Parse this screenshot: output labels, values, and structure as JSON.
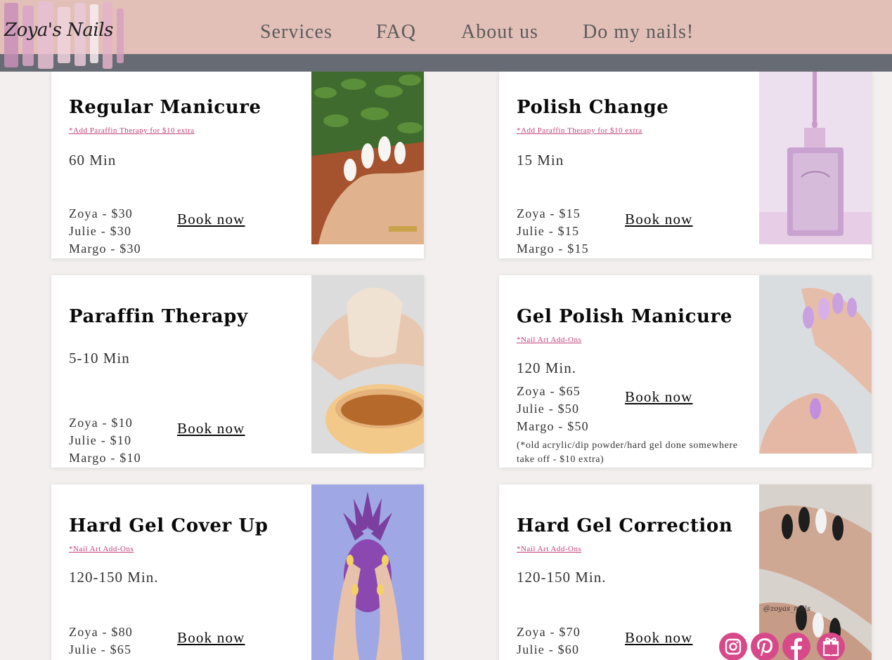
{
  "brand": {
    "logo_text": "Zoya's Nails"
  },
  "nav": {
    "services": "Services",
    "faq": "FAQ",
    "about": "About us",
    "book": "Do my nails!"
  },
  "colors": {
    "header": "#e2c0b8",
    "subbar": "#676b74",
    "accent": "#c2417a",
    "background": "#f3efee",
    "social": "#d8498a"
  },
  "services": [
    {
      "title": "Regular Manicure",
      "addon": "*Add Paraffin Therapy for $10 extra",
      "duration": "60 Min",
      "prices": [
        "Zoya - $30",
        "Julie - $30",
        "Margo - $30"
      ],
      "book": "Book now",
      "photo": "white-nails-plant-photo"
    },
    {
      "title": "Polish Change",
      "addon": "*Add Paraffin Therapy for $10 extra",
      "duration": "15 Min",
      "prices": [
        "Zoya - $15",
        "Julie - $15",
        "Margo - $15"
      ],
      "book": "Book now",
      "photo": "polish-bottle-photo"
    },
    {
      "title": "Paraffin Therapy",
      "duration": "5-10 Min",
      "prices": [
        "Zoya - $10",
        "Julie - $10",
        "Margo - $10"
      ],
      "book": "Book now",
      "photo": "paraffin-wax-photo"
    },
    {
      "title": "Gel Polish Manicure",
      "addon": "*Nail Art Add-Ons",
      "duration": "120 Min.",
      "prices": [
        "Zoya - $65",
        "Julie - $50",
        "Margo - $50"
      ],
      "book": "Book now",
      "note": "(*old acrylic/dip powder/hard gel done somewhere take off - $10 extra)",
      "photo": "lilac-nails-photo"
    },
    {
      "title": "Hard Gel Cover Up",
      "addon": "*Nail Art Add-Ons",
      "duration": "120-150 Min.",
      "prices": [
        "Zoya - $80",
        "Julie - $65"
      ],
      "book": "Book now",
      "photo": "pineapple-hands-photo"
    },
    {
      "title": "Hard Gel Correction",
      "addon": "*Nail Art Add-Ons",
      "duration": "120-150 Min.",
      "prices": [
        "Zoya - $70",
        "Julie - $60"
      ],
      "book": "Book now",
      "photo": "black-matte-nails-photo"
    }
  ],
  "photo_watermark": "@zoyas_nails",
  "social": [
    {
      "icon": "instagram-icon"
    },
    {
      "icon": "pinterest-icon"
    },
    {
      "icon": "facebook-icon"
    },
    {
      "icon": "gift-icon"
    }
  ]
}
